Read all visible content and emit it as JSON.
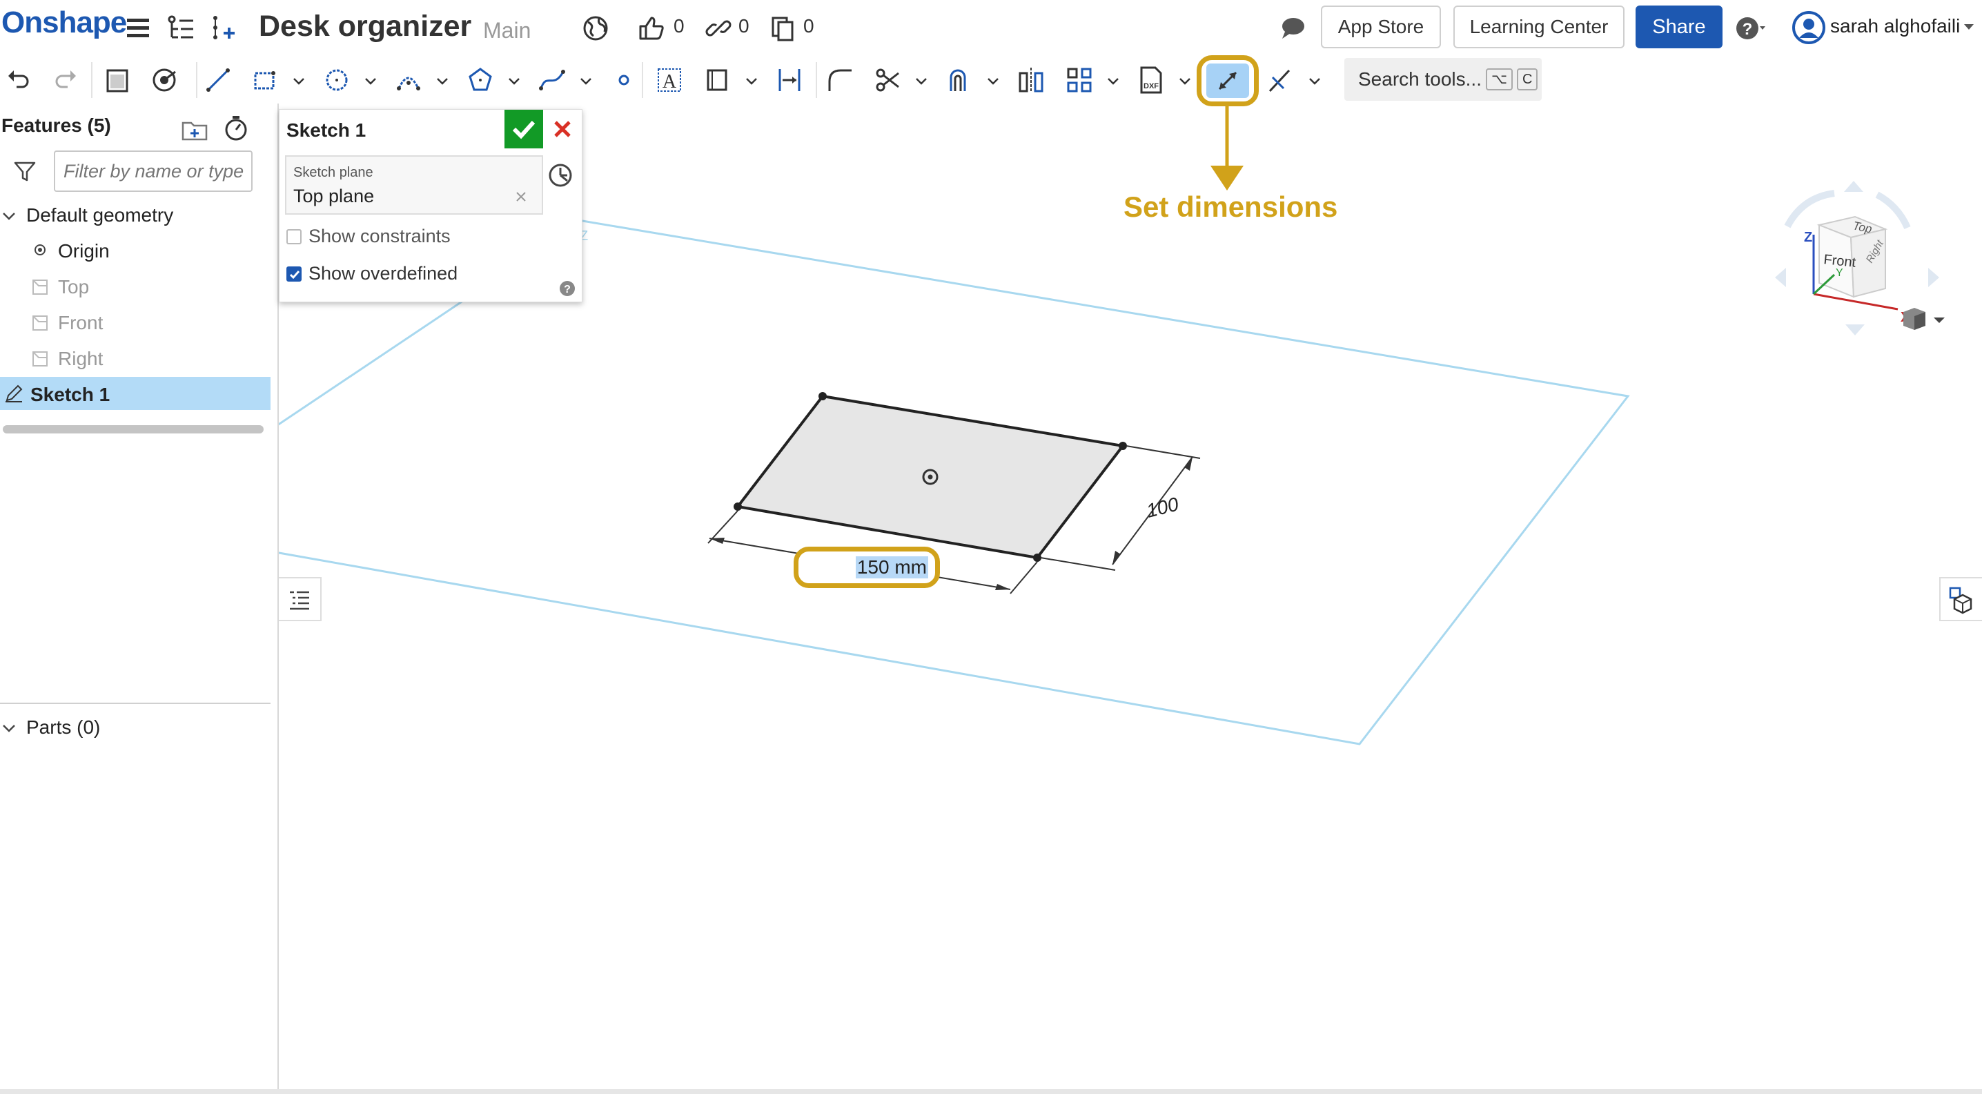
{
  "app": {
    "logo": "Onshape",
    "document_title": "Desk organizer",
    "branch": "Main",
    "likes_count": "0",
    "links_count": "0",
    "copies_count": "0"
  },
  "header": {
    "app_store": "App Store",
    "learning_center": "Learning Center",
    "share": "Share",
    "user_name": "sarah alghofaili"
  },
  "toolbar": {
    "search_label": "Search tools...",
    "search_shortcut_1": "⌥",
    "search_shortcut_2": "C"
  },
  "features": {
    "title": "Features (5)",
    "filter_placeholder": "Filter by name or type",
    "default_geometry": "Default geometry",
    "items": [
      "Origin",
      "Top",
      "Front",
      "Right"
    ],
    "sketch": "Sketch 1",
    "parts": "Parts (0)"
  },
  "sketch_dialog": {
    "title": "Sketch 1",
    "plane_label": "Sketch plane",
    "plane_value": "Top plane",
    "show_constraints": "Show constraints",
    "show_overdefined": "Show overdefined",
    "show_constraints_checked": false,
    "show_overdefined_checked": true
  },
  "viewport": {
    "annotation": "Set dimensions",
    "dimension_input": "150 mm",
    "dimension_vertical": "100",
    "view_cube": {
      "top": "Top",
      "front": "Front",
      "right": "Right",
      "axis_x": "X",
      "axis_y": "Y",
      "axis_z": "Z"
    }
  },
  "colors": {
    "brand": "#1d58b1",
    "accent_annotation": "#d1a21a",
    "ok_green": "#129a26",
    "cancel_red": "#d93025",
    "selection": "#b3dbf7",
    "plane_line": "#a8d8ef"
  }
}
